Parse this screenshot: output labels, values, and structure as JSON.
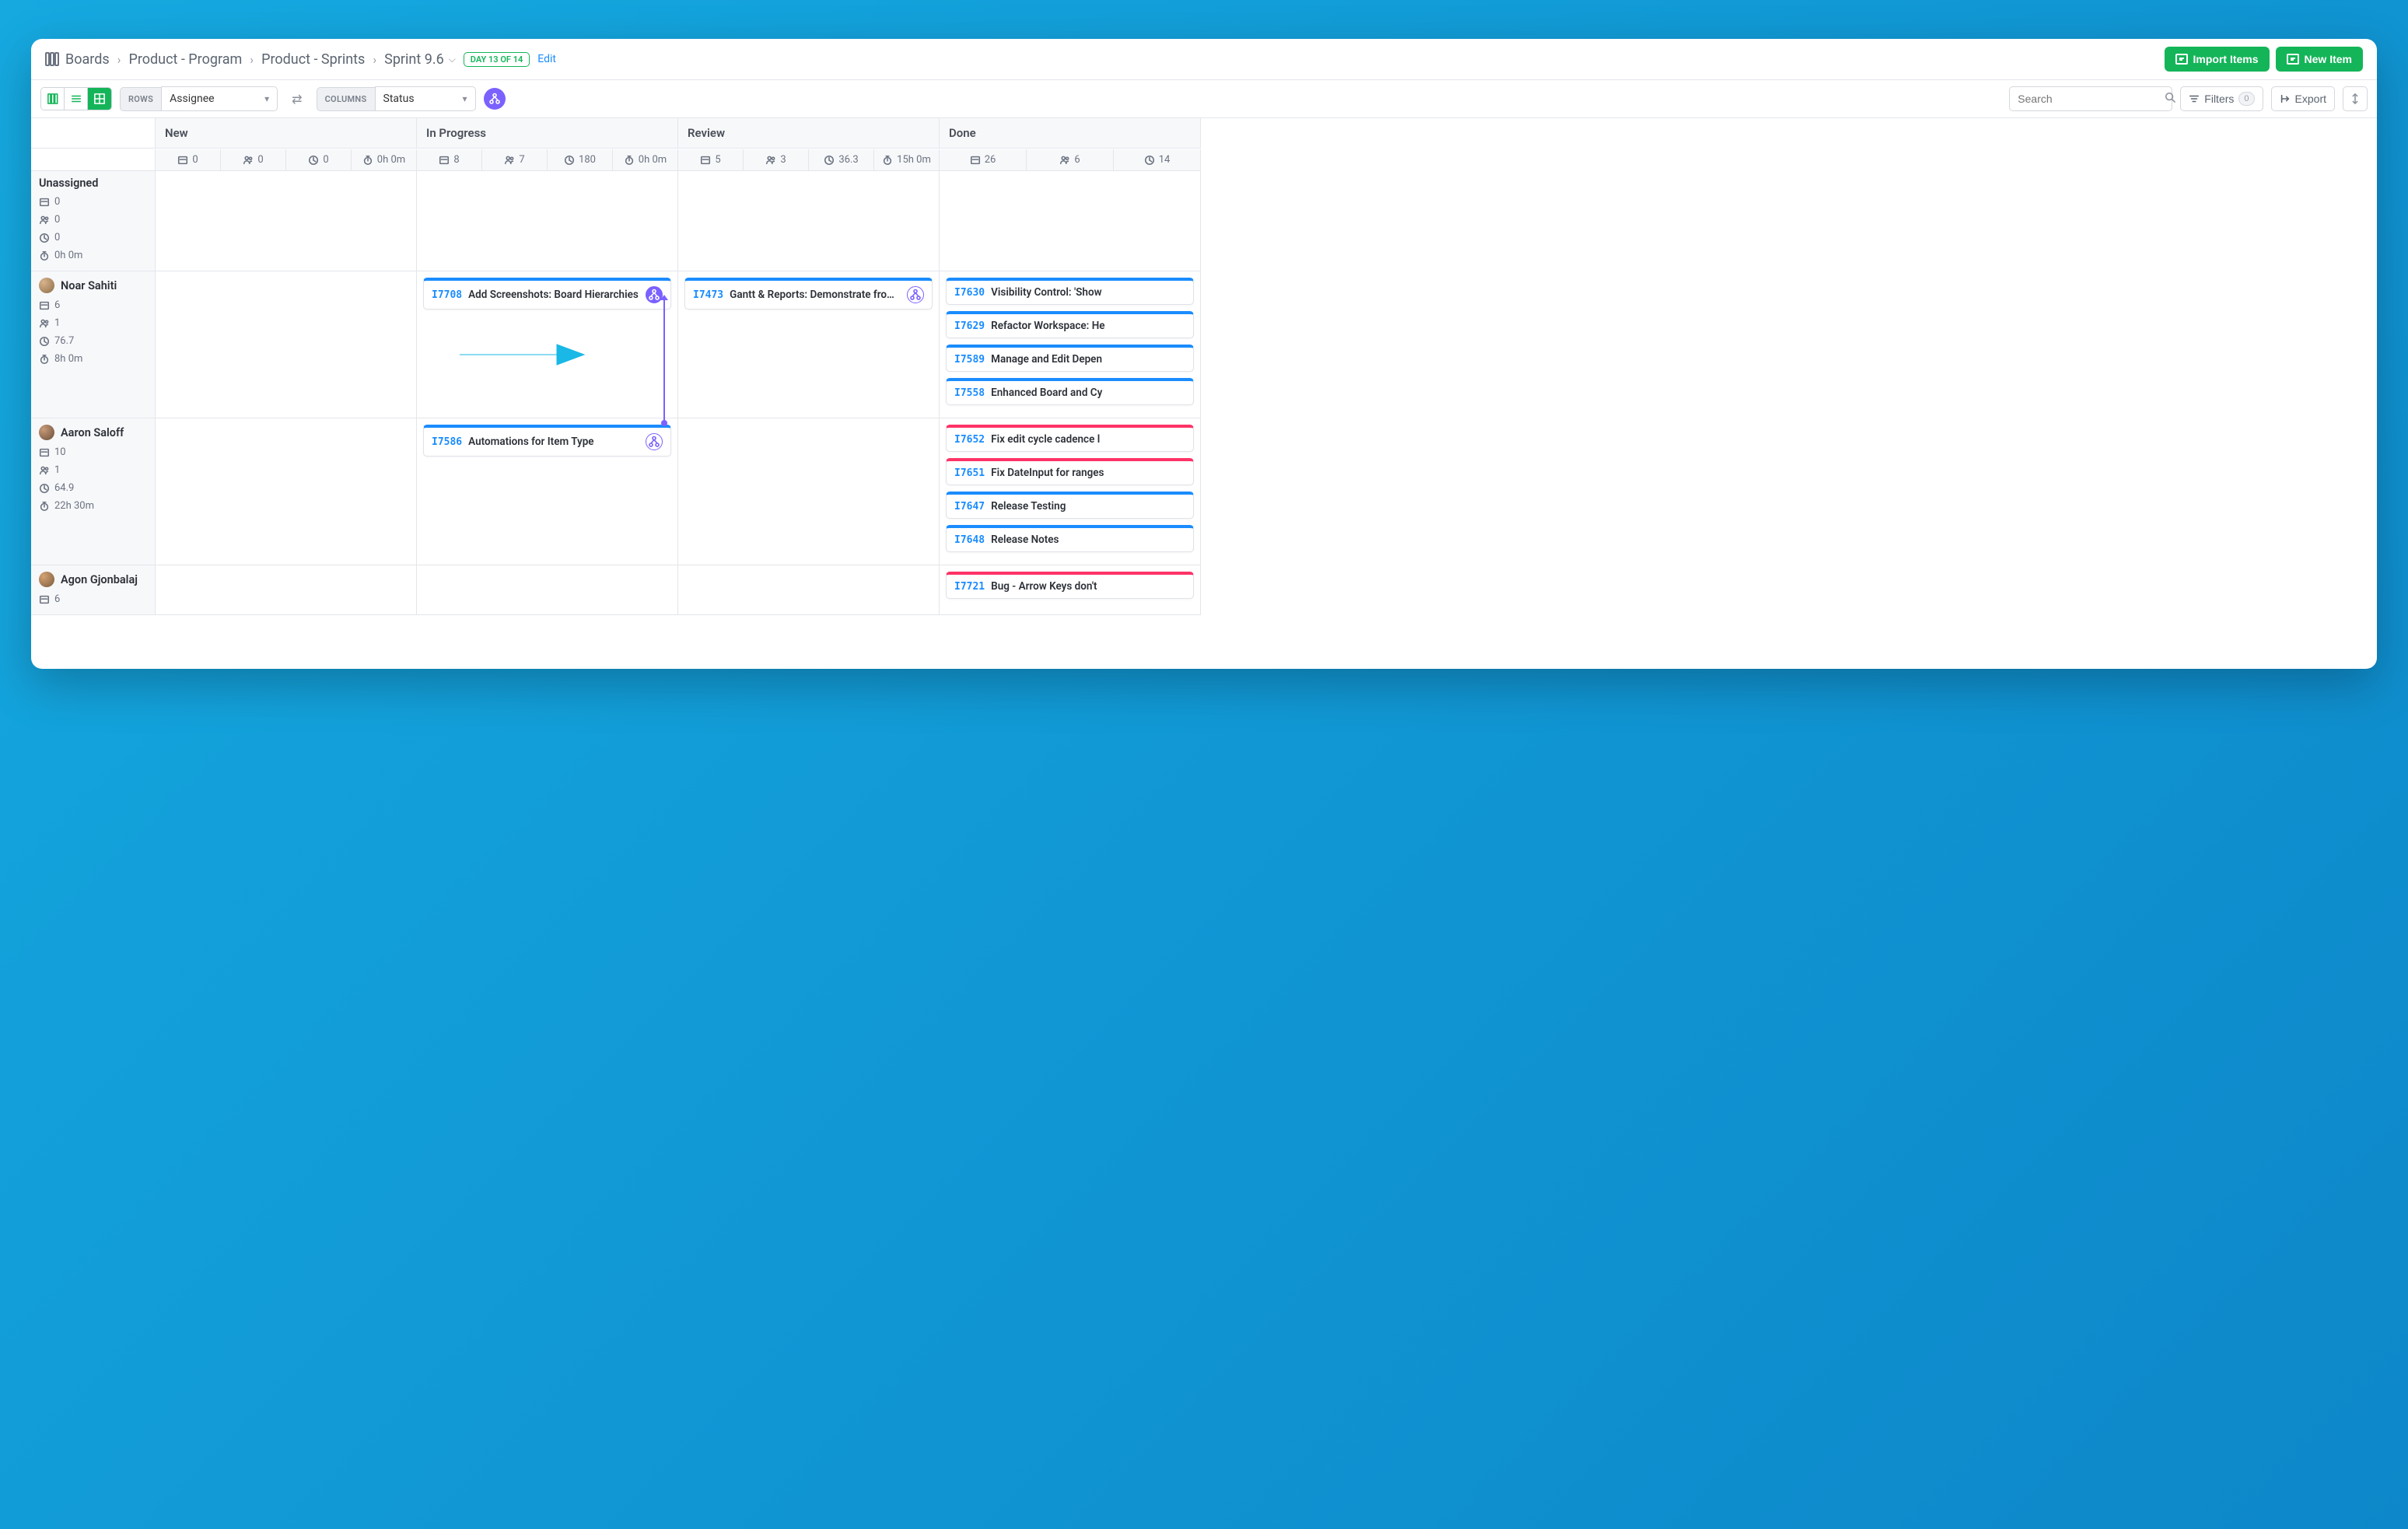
{
  "breadcrumb": {
    "root": "Boards",
    "level1": "Product - Program",
    "level2": "Product - Sprints",
    "current": "Sprint 9.6",
    "day_badge": "DAY 13 OF 14",
    "edit": "Edit"
  },
  "header_buttons": {
    "import": "Import Items",
    "new_item": "New Item"
  },
  "toolbar": {
    "rows_label": "ROWS",
    "rows_value": "Assignee",
    "cols_label": "COLUMNS",
    "cols_value": "Status",
    "search_placeholder": "Search",
    "filters_label": "Filters",
    "filters_count": "0",
    "export_label": "Export"
  },
  "columns": [
    {
      "name": "New",
      "items": "0",
      "people": "0",
      "points": "0",
      "time": "0h 0m"
    },
    {
      "name": "In Progress",
      "items": "8",
      "people": "7",
      "points": "180",
      "time": "0h 0m"
    },
    {
      "name": "Review",
      "items": "5",
      "people": "3",
      "points": "36.3",
      "time": "15h 0m"
    },
    {
      "name": "Done",
      "items": "26",
      "people": "6",
      "points": "14"
    }
  ],
  "rows": [
    {
      "name": "Unassigned",
      "avatar": false,
      "stats": {
        "items": "0",
        "people": "0",
        "points": "0",
        "time": "0h 0m"
      },
      "cells": {
        "New": [],
        "In Progress": [],
        "Review": [],
        "Done": []
      }
    },
    {
      "name": "Noar Sahiti",
      "avatar": "av1",
      "stats": {
        "items": "6",
        "people": "1",
        "points": "76.7",
        "time": "8h 0m"
      },
      "cells": {
        "New": [],
        "In Progress": [
          {
            "id": "I7708",
            "title": "Add Screenshots: Board Hierarchies",
            "node": "filled",
            "color": "blue"
          }
        ],
        "Review": [
          {
            "id": "I7473",
            "title": "Gantt & Reports: Demonstrate from one…",
            "node": "outline",
            "color": "blue"
          }
        ],
        "Done": [
          {
            "id": "I7630",
            "title": "Visibility Control: 'Show",
            "color": "blue"
          },
          {
            "id": "I7629",
            "title": "Refactor Workspace: He",
            "color": "blue"
          },
          {
            "id": "I7589",
            "title": "Manage and Edit Depen",
            "color": "blue"
          },
          {
            "id": "I7558",
            "title": "Enhanced Board and Cy",
            "color": "blue"
          }
        ]
      }
    },
    {
      "name": "Aaron Saloff",
      "avatar": "av2",
      "stats": {
        "items": "10",
        "people": "1",
        "points": "64.9",
        "time": "22h 30m"
      },
      "cells": {
        "New": [],
        "In Progress": [
          {
            "id": "I7586",
            "title": "Automations for Item Type",
            "node": "outline",
            "color": "blue"
          }
        ],
        "Review": [],
        "Done": [
          {
            "id": "I7652",
            "title": "Fix edit cycle cadence l",
            "color": "red"
          },
          {
            "id": "I7651",
            "title": "Fix DateInput for ranges",
            "color": "red"
          },
          {
            "id": "I7647",
            "title": "Release Testing",
            "color": "blue"
          },
          {
            "id": "I7648",
            "title": "Release Notes",
            "color": "blue"
          }
        ]
      }
    },
    {
      "name": "Agon Gjonbalaj",
      "avatar": "av3",
      "stats": {
        "items": "6"
      },
      "cells": {
        "New": [],
        "In Progress": [],
        "Review": [],
        "Done": [
          {
            "id": "I7721",
            "title": "Bug - Arrow Keys don't",
            "color": "red"
          }
        ]
      }
    }
  ]
}
